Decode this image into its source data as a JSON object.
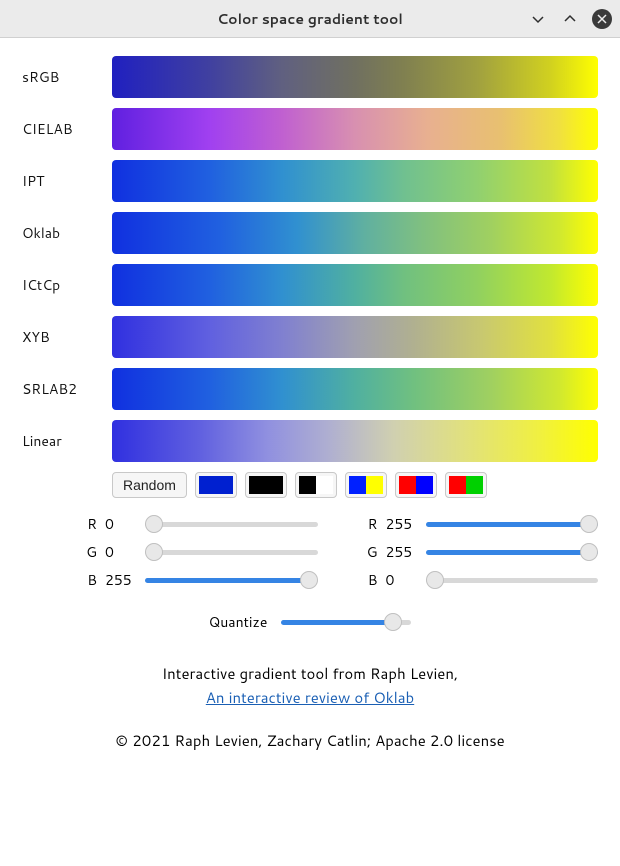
{
  "window": {
    "title": "Color space gradient tool"
  },
  "gradients": [
    {
      "label": "sRGB",
      "class": "g-srgb"
    },
    {
      "label": "CIELAB",
      "class": "g-cielab"
    },
    {
      "label": "IPT",
      "class": "g-ipt"
    },
    {
      "label": "Oklab",
      "class": "g-oklab"
    },
    {
      "label": "ICtCp",
      "class": "g-ictcp"
    },
    {
      "label": "XYB",
      "class": "g-xyb"
    },
    {
      "label": "SRLAB2",
      "class": "g-srlab2"
    },
    {
      "label": "Linear",
      "class": "g-linear"
    }
  ],
  "random_label": "Random",
  "presets": [
    {
      "left": "#0020d0",
      "right": "#0020d0"
    },
    {
      "left": "#000000",
      "right": "#000000"
    },
    {
      "left": "#000000",
      "right": "#ffffff"
    },
    {
      "left": "#0020ff",
      "right": "#ffff00"
    },
    {
      "left": "#ff0000",
      "right": "#0000ff"
    },
    {
      "left": "#ff0000",
      "right": "#00d000"
    }
  ],
  "left": {
    "r": {
      "ch": "R",
      "val": "0"
    },
    "g": {
      "ch": "G",
      "val": "0"
    },
    "b": {
      "ch": "B",
      "val": "255"
    }
  },
  "right": {
    "r": {
      "ch": "R",
      "val": "255"
    },
    "g": {
      "ch": "G",
      "val": "255"
    },
    "b": {
      "ch": "B",
      "val": "0"
    }
  },
  "quantize_label": "Quantize",
  "credit_line1": "Interactive gradient tool from Raph Levien,",
  "credit_link": "An interactive review of Oklab",
  "copyright": "© 2021 Raph Levien, Zachary Catlin; Apache 2.0 license"
}
